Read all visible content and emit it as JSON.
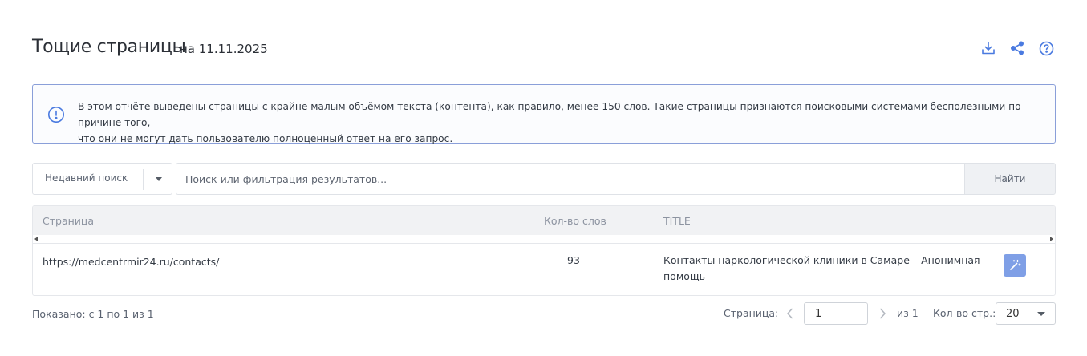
{
  "header": {
    "title": "Тощие страницы",
    "subtitle": "на 11.11.2025",
    "icons": [
      "download-icon",
      "share-icon",
      "help-icon"
    ]
  },
  "info": {
    "icon": "info-circle-icon",
    "text_line1": "В этом отчёте выведены страницы с крайне малым объёмом текста (контента), как правило, менее 150 слов. Такие страницы признаются поисковыми системами бесполезными по причине того,",
    "text_line2": "что они не могут дать пользователю полноценный ответ на его запрос."
  },
  "search": {
    "recent_label": "Недавний поиск",
    "placeholder": "Поиск или фильтрация результатов...",
    "find_label": "Найти"
  },
  "table": {
    "columns": [
      "Страница",
      "Кол-во слов",
      "TITLE"
    ],
    "rows": [
      {
        "page": "https://medcentrmir24.ru/contacts/",
        "words": "93",
        "title_line1": "Контакты наркологической клиники в Самаре – Анонимная",
        "title_line2": "помощь",
        "action_icon": "magic-wand-icon"
      }
    ]
  },
  "footer": {
    "shown": "Показано: с 1 по 1 из 1",
    "page_label": "Страница:",
    "page_value": "1",
    "of_pages": "из 1",
    "page_size_label": "Кол-во стр.:",
    "page_size_value": "20"
  },
  "colors": {
    "accent": "#4a7ae0",
    "info_border": "#8a9fd9",
    "action_button": "#7f9fe6",
    "header_bg": "#f1f2f4"
  }
}
